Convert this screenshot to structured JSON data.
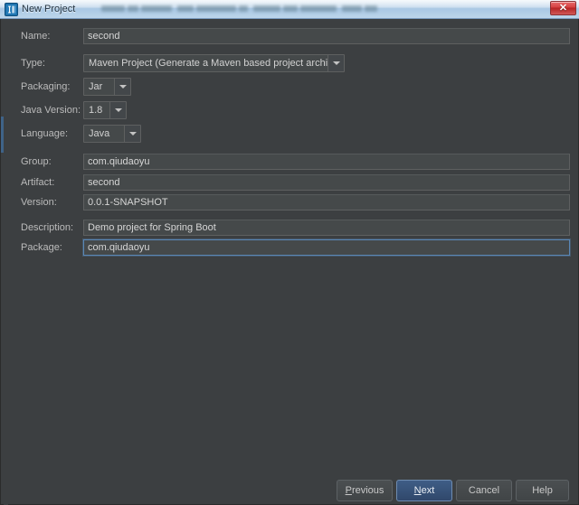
{
  "window": {
    "title": "New Project",
    "icon": "intellij-idea-icon",
    "redacted_title_segment": "blurred-path-text",
    "close_label": "✕",
    "colors": {
      "dialog_background": "#3c3f41",
      "input_background": "#45494a",
      "border": "#5e6060",
      "focus_border": "#5a87b5",
      "default_button": "#3f5d86",
      "title_text": "#20313f",
      "label_text": "#bbbbbb",
      "close_button": "#d64141"
    }
  },
  "form": {
    "fields": [
      {
        "label": "Name:",
        "value": "second",
        "kind": "text",
        "focused": false,
        "name": "name"
      },
      {
        "label": "Type:",
        "value": "Maven Project (Generate a Maven based project archive)",
        "kind": "combo",
        "focused": false,
        "name": "type"
      },
      {
        "label": "Packaging:",
        "value": "Jar",
        "kind": "combo",
        "focused": false,
        "name": "packaging"
      },
      {
        "label": "Java Version:",
        "value": "1.8",
        "kind": "combo",
        "focused": false,
        "name": "java-version"
      },
      {
        "label": "Language:",
        "value": "Java",
        "kind": "combo",
        "focused": false,
        "name": "language"
      },
      {
        "label": "Group:",
        "value": "com.qiudaoyu",
        "kind": "text",
        "focused": false,
        "name": "group"
      },
      {
        "label": "Artifact:",
        "value": "second",
        "kind": "text",
        "focused": false,
        "name": "artifact"
      },
      {
        "label": "Version:",
        "value": "0.0.1-SNAPSHOT",
        "kind": "text",
        "focused": false,
        "name": "version"
      },
      {
        "label": "Description:",
        "value": "Demo project for Spring Boot",
        "kind": "text",
        "focused": false,
        "name": "description"
      },
      {
        "label": "Package:",
        "value": "com.qiudaoyu",
        "kind": "text",
        "focused": true,
        "name": "package"
      }
    ]
  },
  "buttons": {
    "previous": {
      "label": "Previous",
      "mnemonic": "P",
      "default": false
    },
    "next": {
      "label": "Next",
      "mnemonic": "N",
      "default": true
    },
    "cancel": {
      "label": "Cancel",
      "mnemonic": "",
      "default": false
    },
    "help": {
      "label": "Help",
      "mnemonic": "",
      "default": false
    }
  }
}
